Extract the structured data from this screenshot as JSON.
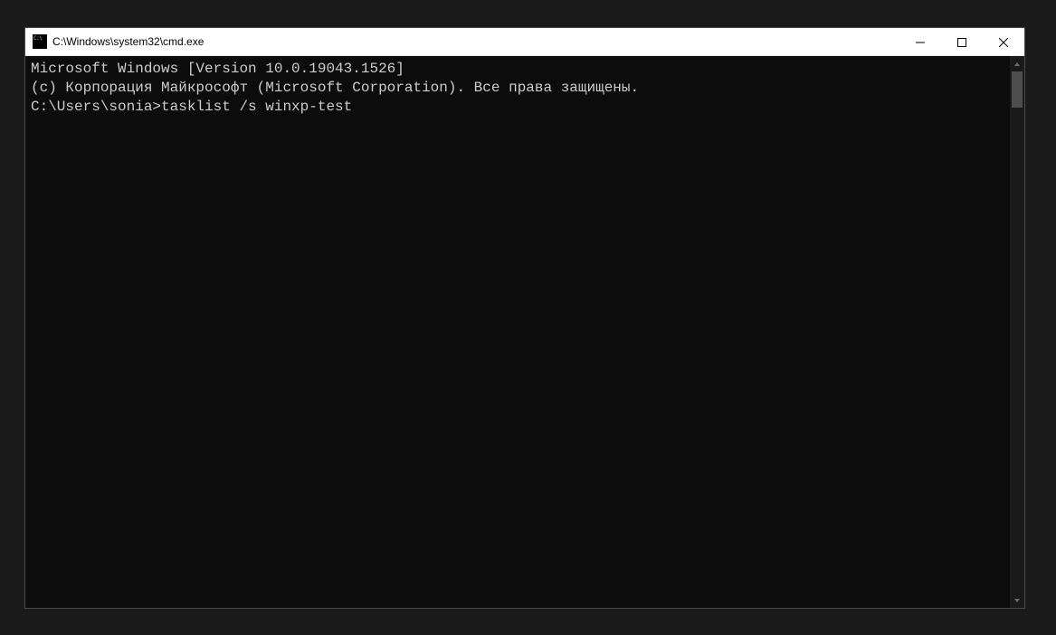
{
  "window": {
    "title": "C:\\Windows\\system32\\cmd.exe"
  },
  "terminal": {
    "lines": [
      "Microsoft Windows [Version 10.0.19043.1526]",
      "(c) Корпорация Майкрософт (Microsoft Corporation). Все права защищены.",
      "",
      "C:\\Users\\sonia>tasklist /s winxp-test"
    ],
    "version_line": "Microsoft Windows [Version 10.0.19043.1526]",
    "copyright_line": "(c) Корпорация Майкрософт (Microsoft Corporation). Все права защищены.",
    "prompt": "C:\\Users\\sonia>",
    "command": "tasklist /s winxp-test"
  }
}
